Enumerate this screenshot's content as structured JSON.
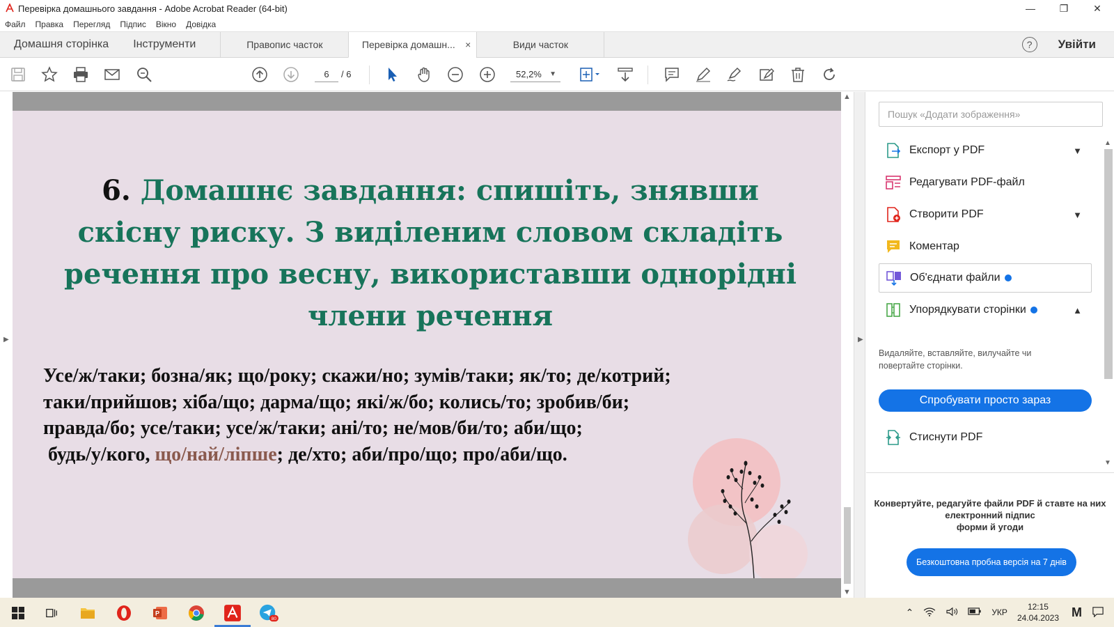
{
  "window": {
    "title": "Перевірка домашнього завдання - Adobe Acrobat Reader (64-bit)",
    "minimize": "—",
    "maximize": "❐",
    "close": "✕"
  },
  "menu": [
    "Файл",
    "Правка",
    "Перегляд",
    "Підпис",
    "Вікно",
    "Довідка"
  ],
  "tabs": {
    "home": "Домашня сторінка",
    "tools": "Інструменти",
    "docs": [
      {
        "label": "Правопис часток",
        "active": false
      },
      {
        "label": "Перевірка домашн...",
        "active": true
      },
      {
        "label": "Види часток",
        "active": false
      }
    ],
    "close_glyph": "×",
    "help": "?",
    "login": "Увійти"
  },
  "toolbar": {
    "current_page": "6",
    "total_pages": "/ 6",
    "zoom": "52,2%"
  },
  "slide": {
    "number": "6.",
    "heading": "Домашнє завдання: спишіть, знявши скісну риску. З виділеним словом складіть речення про весну, використавши однорідні члени речення",
    "lines": [
      "Усе/ж/таки; бозна/як; що/року; скажи/но; зумів/таки; як/то; де/котрий;",
      "таки/прийшов; хіба/що; дарма/що; які/ж/бо; колись/то; зробив/би;",
      "правда/бо; усе/таки; усе/ж/таки; ані/то; не/мов/би/то; аби/що;"
    ],
    "last_line_before": " будь/у/кого, ",
    "last_line_highlight": "що/най/ліпше",
    "last_line_after": "; де/хто; аби/про/що; про/аби/що."
  },
  "sidebar": {
    "search_placeholder": "Пошук «Додати зображення»",
    "tools": [
      {
        "label": "Експорт у PDF",
        "icon": "export-pdf-icon",
        "chevron": "⌄"
      },
      {
        "label": "Редагувати PDF-файл",
        "icon": "edit-pdf-icon",
        "chevron": ""
      },
      {
        "label": "Створити PDF",
        "icon": "create-pdf-icon",
        "chevron": "⌄"
      },
      {
        "label": "Коментар",
        "icon": "comment-icon",
        "chevron": ""
      },
      {
        "label": "Об'єднати файли",
        "icon": "combine-files-icon",
        "chevron": ""
      },
      {
        "label": "Упорядкувати сторінки",
        "icon": "organize-pages-icon",
        "chevron": "⌃"
      },
      {
        "label": "Стиснути PDF",
        "icon": "compress-pdf-icon",
        "chevron": ""
      }
    ],
    "organize_desc": "Видаляйте, вставляйте, вилучайте чи повертайте сторінки.",
    "try_button": "Спробувати просто зараз",
    "promo_text_1": "Конвертуйте, редагуйте файли PDF й ставте на них",
    "promo_text_2": "електронний підпис",
    "promo_text_3": "форми й угоди",
    "promo_button": "Безкоштовна пробна версія на 7 днів"
  },
  "taskbar": {
    "lang": "УКР",
    "time": "12:15",
    "date": "24.04.2023",
    "telegram_badge": "80"
  },
  "colors": {
    "heading_green": "#17745a",
    "slide_bg": "#e8dde6",
    "accent_blue": "#1473e6",
    "highlight_brown": "#8a5a4e"
  }
}
